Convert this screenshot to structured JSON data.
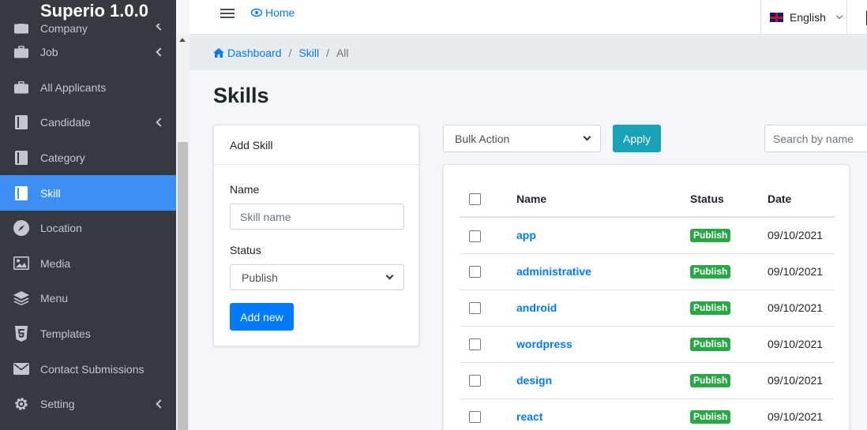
{
  "app": {
    "brand": "Superio 1.0.0"
  },
  "sidebar": {
    "items": [
      {
        "label": "Company",
        "icon": "briefcase-icon",
        "has_children": true
      },
      {
        "label": "Job",
        "icon": "briefcase-icon",
        "has_children": true
      },
      {
        "label": "All Applicants",
        "icon": "briefcase-icon",
        "has_children": false
      },
      {
        "label": "Candidate",
        "icon": "book-icon",
        "has_children": true
      },
      {
        "label": "Category",
        "icon": "book-icon",
        "has_children": false
      },
      {
        "label": "Skill",
        "icon": "book-icon",
        "has_children": false,
        "active": true
      },
      {
        "label": "Location",
        "icon": "compass-icon",
        "has_children": false
      },
      {
        "label": "Media",
        "icon": "image-icon",
        "has_children": false
      },
      {
        "label": "Menu",
        "icon": "layers-icon",
        "has_children": false
      },
      {
        "label": "Templates",
        "icon": "html5-icon",
        "has_children": false
      },
      {
        "label": "Contact Submissions",
        "icon": "envelope-icon",
        "has_children": false
      },
      {
        "label": "Setting",
        "icon": "gear-icon",
        "has_children": true
      }
    ]
  },
  "topbar": {
    "home_label": "Home",
    "language": "English"
  },
  "breadcrumb": {
    "dashboard": "Dashboard",
    "skill": "Skill",
    "current": "All"
  },
  "page": {
    "title": "Skills"
  },
  "add_form": {
    "header": "Add Skill",
    "name_label": "Name",
    "name_placeholder": "Skill name",
    "status_label": "Status",
    "status_value": "Publish",
    "submit_label": "Add new"
  },
  "toolbar": {
    "bulk_action": "Bulk Action",
    "apply_label": "Apply",
    "search_placeholder": "Search by name"
  },
  "table": {
    "headers": {
      "name": "Name",
      "status": "Status",
      "date": "Date"
    },
    "rows": [
      {
        "name": "app",
        "status": "Publish",
        "date": "09/10/2021"
      },
      {
        "name": "administrative",
        "status": "Publish",
        "date": "09/10/2021"
      },
      {
        "name": "android",
        "status": "Publish",
        "date": "09/10/2021"
      },
      {
        "name": "wordpress",
        "status": "Publish",
        "date": "09/10/2021"
      },
      {
        "name": "design",
        "status": "Publish",
        "date": "09/10/2021"
      },
      {
        "name": "react",
        "status": "Publish",
        "date": "09/10/2021"
      }
    ]
  },
  "colors": {
    "sidebar_bg": "#343a40",
    "active": "#3b8ff5",
    "primary": "#007bff",
    "apply": "#17a2b8",
    "publish_badge": "#28a745"
  }
}
